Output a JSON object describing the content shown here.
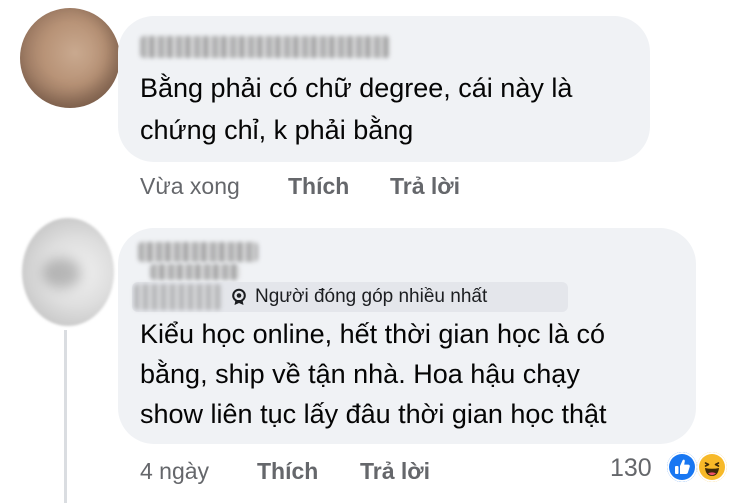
{
  "comments": [
    {
      "text_lines": [
        "Bằng phải có chữ degree, cái này là",
        "chứng chỉ, k phải bằng"
      ],
      "time": "Vừa xong",
      "like_label": "Thích",
      "reply_label": "Trả lời"
    },
    {
      "badge": "Người đóng góp nhiều nhất",
      "text_lines": [
        "Kiểu học online, hết thời gian học là có",
        "bằng, ship về tận nhà. Hoa hậu chạy",
        "show liên tục lấy đâu thời gian học thật"
      ],
      "time": "4 ngày",
      "like_label": "Thích",
      "reply_label": "Trả lời",
      "reaction_count": "130",
      "reactions": [
        "like-icon",
        "haha-icon"
      ]
    }
  ],
  "colors": {
    "bubble": "#f0f2f5",
    "meta": "#65676b",
    "like": "#1877f2",
    "haha": "#f7b928"
  }
}
